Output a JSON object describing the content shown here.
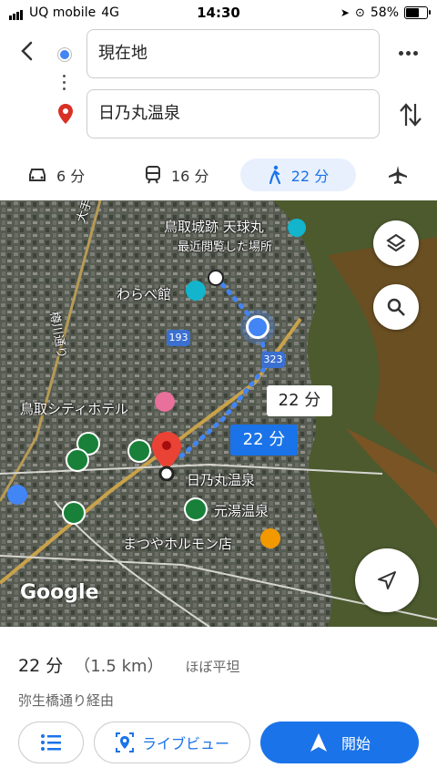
{
  "status": {
    "carrier": "UQ mobile",
    "network": "4G",
    "time": "14:30",
    "battery": "58%",
    "battery_level": 0.58
  },
  "route": {
    "origin": "現在地",
    "destination": "日乃丸温泉"
  },
  "modes": [
    {
      "name": "car",
      "label": "6 分"
    },
    {
      "name": "transit",
      "label": "16 分"
    },
    {
      "name": "walk",
      "label": "22 分"
    },
    {
      "name": "flight",
      "label": ""
    }
  ],
  "map": {
    "labels": {
      "castle": "鳥取城跡 天球丸",
      "recent": "最近閲覧した場所",
      "warabe": "わらべ館",
      "hotel": "鳥取シティホテル",
      "dest": "日乃丸温泉",
      "motoyu": "元湯温泉",
      "matsuya": "まつやホルモン店",
      "road193": "193",
      "road323": "323",
      "street_left": "大手通り",
      "street_mid": "樽川通り"
    },
    "callout_alt": "22 分",
    "callout_main": "22 分",
    "logo": "Google"
  },
  "summary": {
    "time": "22 分",
    "distance": "（1.5 km）",
    "terrain": "ほぼ平坦",
    "via": "弥生橋通り経由"
  },
  "buttons": {
    "steps": "",
    "live_view": "ライブビュー",
    "start": "開始"
  },
  "colors": {
    "accent": "#1a73e8",
    "route_dots": "#4285f4",
    "pin": "#ea4335"
  }
}
